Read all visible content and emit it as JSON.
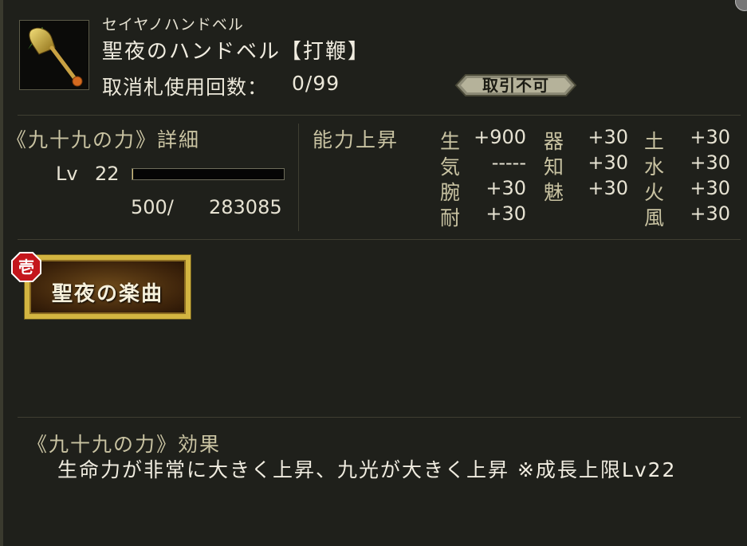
{
  "item": {
    "kana": "セイヤノハンドベル",
    "name": "聖夜のハンドベル【打鞭】",
    "cancel_label": "取消札使用回数：",
    "cancel_value": "0/99",
    "trade_badge": "取引不可",
    "icon": "handbell-icon"
  },
  "detail": {
    "heading": "《九十九の力》詳細",
    "lv_label": "Lv",
    "lv_value": "22",
    "exp_current": "500/",
    "exp_max": "283085",
    "exp_progress": 0.0018
  },
  "ability": {
    "heading": "能力上昇",
    "stats": [
      {
        "name": "生",
        "value": "+900"
      },
      {
        "name": "気",
        "value": "-----"
      },
      {
        "name": "腕",
        "value": "+30"
      },
      {
        "name": "耐",
        "value": "+30"
      },
      {
        "name": "器",
        "value": "+30"
      },
      {
        "name": "知",
        "value": "+30"
      },
      {
        "name": "魅",
        "value": "+30"
      },
      {
        "name": "土",
        "value": "+30"
      },
      {
        "name": "水",
        "value": "+30"
      },
      {
        "name": "火",
        "value": "+30"
      },
      {
        "name": "風",
        "value": "+30"
      }
    ]
  },
  "skill": {
    "rank": "壱",
    "name": "聖夜の楽曲"
  },
  "effect": {
    "heading": "《九十九の力》効果",
    "text": "生命力が非常に大きく上昇、九光が大きく上昇 ※成長上限Lv22"
  },
  "colors": {
    "panel_bg": "#1f201b",
    "heading": "#c9c3a2",
    "gold_plate": "#d3b541",
    "rank_badge": "#c4161c"
  }
}
